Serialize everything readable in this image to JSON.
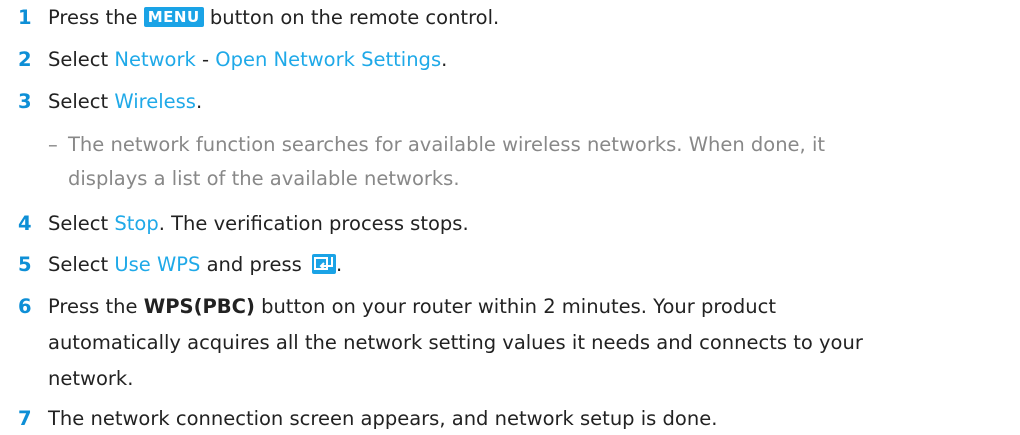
{
  "steps": [
    {
      "num": "1",
      "t1": "Press the ",
      "badge": "MENU",
      "t2": " button on the remote control."
    },
    {
      "num": "2",
      "t1": "Select ",
      "h1": "Network",
      "t2": " - ",
      "h2": "Open Network Settings",
      "t3": "."
    },
    {
      "num": "3",
      "t1": "Select ",
      "h1": "Wireless",
      "t2": "."
    },
    {
      "num": "4",
      "t1": "Select ",
      "h1": "Stop",
      "t2": ". The verification process stops."
    },
    {
      "num": "5",
      "t1": "Select ",
      "h1": "Use WPS",
      "t2": " and press ",
      "t3": "."
    },
    {
      "num": "6",
      "t1": "Press the ",
      "b1": "WPS(PBC)",
      "t2": " button on your router within 2 minutes. Your product",
      "line2": "automatically acquires all the network setting values it needs and connects to your",
      "line3": "network."
    },
    {
      "num": "7",
      "t1": "The network connection screen appears, and network setup is done."
    }
  ],
  "note": {
    "dash": "–",
    "line1": "The network function searches for available wireless networks. When done, it",
    "line2": "displays a list of the available networks."
  },
  "icons": {
    "enter": "enter-key-icon"
  },
  "colors": {
    "number": "#0e8fd6",
    "highlight": "#1fa9e8",
    "badge_bg": "#1aa3e6",
    "note_text": "#888888"
  }
}
